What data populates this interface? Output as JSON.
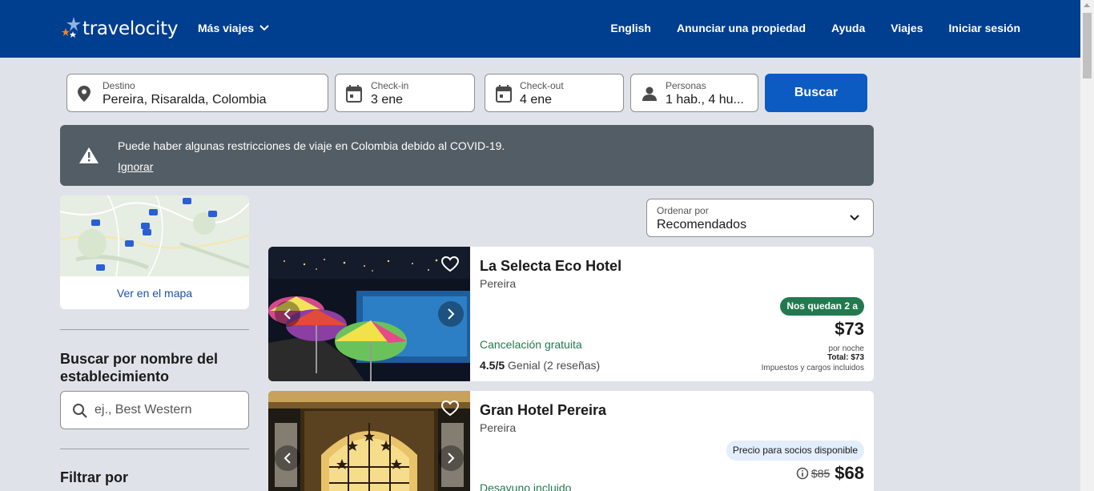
{
  "header": {
    "logo_text": "travelocity",
    "more_trips": "Más viajes",
    "nav": [
      "English",
      "Anunciar una propiedad",
      "Ayuda",
      "Viajes",
      "Iniciar sesión"
    ]
  },
  "search": {
    "destination": {
      "label": "Destino",
      "value": "Pereira, Risaralda, Colombia"
    },
    "checkin": {
      "label": "Check-in",
      "value": "3 ene"
    },
    "checkout": {
      "label": "Check-out",
      "value": "4 ene"
    },
    "guests": {
      "label": "Personas",
      "value": "1 hab., 4 hu..."
    },
    "button": "Buscar"
  },
  "banner": {
    "message": "Puede haber algunas restricciones de viaje en Colombia debido al COVID-19.",
    "dismiss": "Ignorar"
  },
  "sidebar": {
    "map_link": "Ver en el mapa",
    "name_search_title": "Buscar por nombre del establecimiento",
    "name_search_placeholder": "ej., Best Western",
    "filter_title": "Filtrar por"
  },
  "sort": {
    "label": "Ordenar por",
    "value": "Recomendados"
  },
  "hotels": [
    {
      "name": "La Selecta Eco Hotel",
      "location": "Pereira",
      "badge": "Nos quedan 2 a",
      "price": "$73",
      "per_night": "por noche",
      "total": "Total: $73",
      "taxes": "Impuestos y cargos incluidos",
      "cancellation": "Cancelación gratuita",
      "rating_score": "4.5/5",
      "rating_text": "Genial (2 reseñas)"
    },
    {
      "name": "Gran Hotel Pereira",
      "location": "Pereira",
      "badge": "Precio para socios disponible",
      "old_price": "$85",
      "price": "$68",
      "amenity": "Desayuno incluido"
    }
  ],
  "colors": {
    "header_bg": "#003e8f",
    "primary_button": "#0c5bc2",
    "banner_bg": "#535d65",
    "success_green": "#227950"
  }
}
